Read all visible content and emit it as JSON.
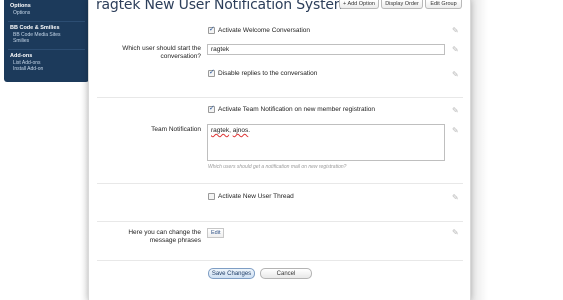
{
  "sidebar": {
    "sections": [
      {
        "heading": "Options",
        "links": [
          "Options"
        ]
      },
      {
        "heading": "BB Code & Smilies",
        "links": [
          "BB Code Media Sites",
          "Smilies"
        ]
      },
      {
        "heading": "Add-ons",
        "links": [
          "List Add-ons",
          "Install Add-on"
        ]
      }
    ]
  },
  "header": {
    "title": "ragtek New User Notification System",
    "buttons": {
      "add_option": "+ Add Option",
      "display_order": "Display Order",
      "edit_group": "Edit Group"
    }
  },
  "form": {
    "welcome": {
      "checkbox_label": "Activate Welcome Conversation",
      "checked": true,
      "user_label_line1": "Which user should start the",
      "user_label_line2": "conversation?",
      "user_value": "ragtek",
      "disable_replies_label": "Disable replies to the conversation",
      "disable_replies_checked": true
    },
    "team": {
      "checkbox_label": "Activate Team Notification on new member registration",
      "checked": true,
      "label": "Team Notification",
      "value_part1": "ragtek",
      "value_part2": ", ",
      "value_part3": "ajnos",
      "value_part4": ".",
      "hint": "Which users should get a notification mail on new registration?"
    },
    "thread": {
      "checkbox_label": "Activate New User Thread",
      "checked": false
    },
    "phrases": {
      "label_line1": "Here you can change the",
      "label_line2": "message phrases",
      "edit_label": "Edit"
    }
  },
  "footer": {
    "save_label": "Save Changes",
    "cancel_label": "Cancel"
  }
}
